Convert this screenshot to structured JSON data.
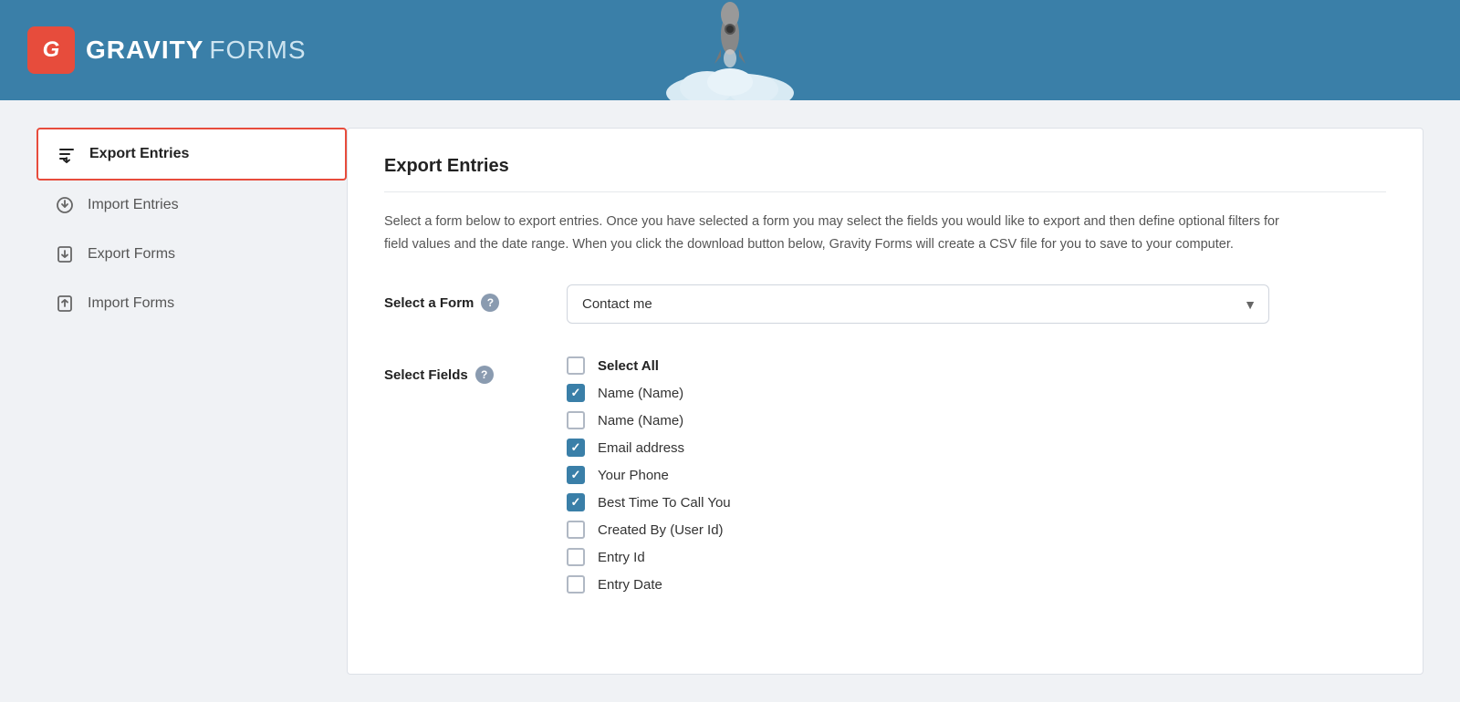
{
  "header": {
    "logo_bold": "GRAVITY",
    "logo_light": "FORMS",
    "logo_letter": "G"
  },
  "sidebar": {
    "items": [
      {
        "id": "export-entries",
        "label": "Export Entries",
        "active": true,
        "icon": "export-entries-icon"
      },
      {
        "id": "import-entries",
        "label": "Import Entries",
        "active": false,
        "icon": "import-entries-icon"
      },
      {
        "id": "export-forms",
        "label": "Export Forms",
        "active": false,
        "icon": "export-forms-icon"
      },
      {
        "id": "import-forms",
        "label": "Import Forms",
        "active": false,
        "icon": "import-forms-icon"
      }
    ]
  },
  "content": {
    "title": "Export Entries",
    "description": "Select a form below to export entries. Once you have selected a form you may select the fields you would like to export and then define optional filters for field values and the date range. When you click the download button below, Gravity Forms will create a CSV file for you to save to your computer.",
    "form_label": "Select a Form",
    "fields_label": "Select Fields",
    "selected_form": "Contact me",
    "fields": [
      {
        "id": "select-all",
        "label": "Select All",
        "checked": false,
        "bold": true
      },
      {
        "id": "name-1",
        "label": "Name (Name)",
        "checked": true
      },
      {
        "id": "name-2",
        "label": "Name (Name)",
        "checked": false
      },
      {
        "id": "email",
        "label": "Email address",
        "checked": true
      },
      {
        "id": "phone",
        "label": "Your Phone",
        "checked": true
      },
      {
        "id": "best-time",
        "label": "Best Time To Call You",
        "checked": true
      },
      {
        "id": "created-by",
        "label": "Created By (User Id)",
        "checked": false
      },
      {
        "id": "entry-id",
        "label": "Entry Id",
        "checked": false
      },
      {
        "id": "entry-date",
        "label": "Entry Date",
        "checked": false
      }
    ],
    "help_text": "?"
  },
  "colors": {
    "header_bg": "#3a7fa8",
    "accent_red": "#e74c3c",
    "checkbox_blue": "#3a7fa8"
  }
}
